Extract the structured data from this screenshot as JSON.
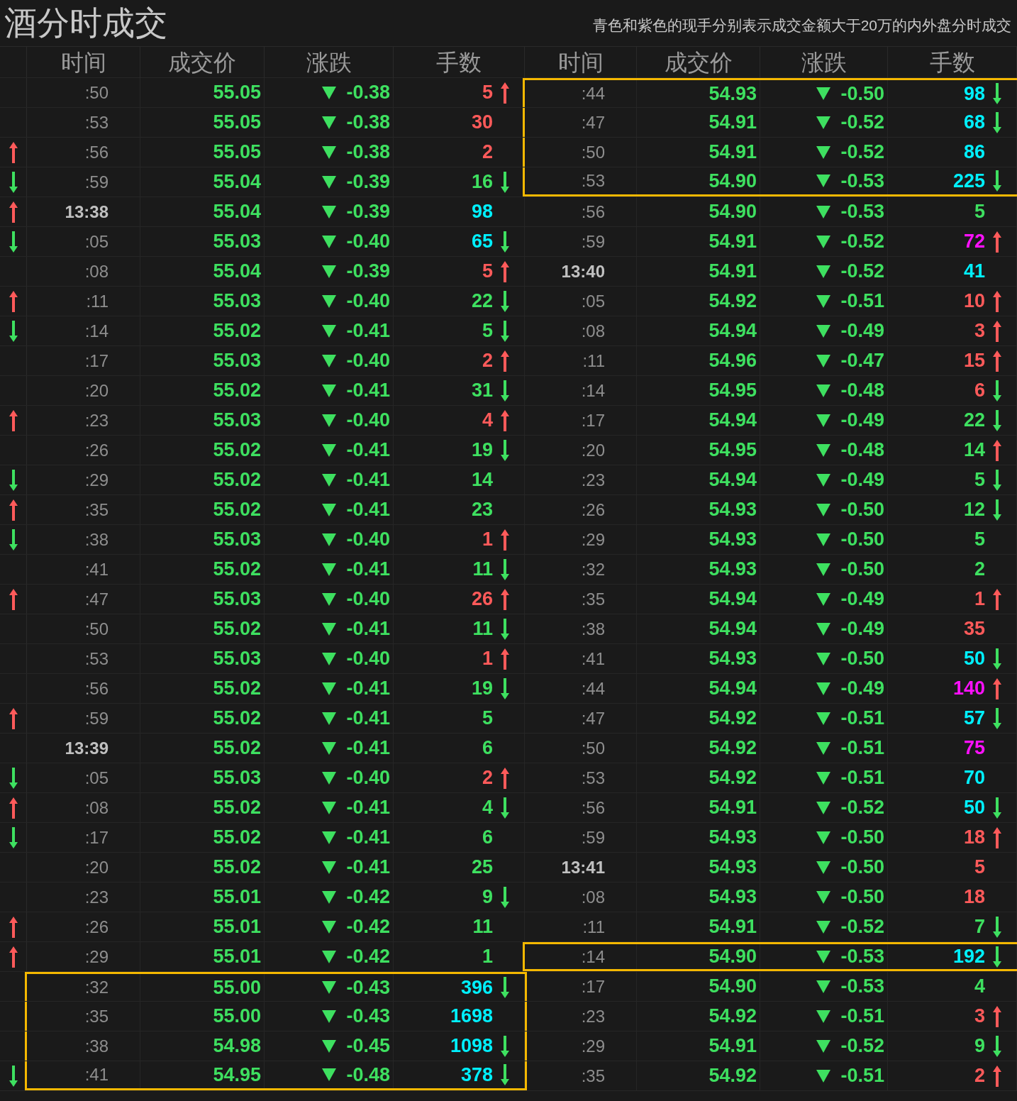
{
  "title": "酒分时成交",
  "notice": "青色和紫色的现手分别表示成交金额大于20万的内外盘分时成交",
  "columns": [
    "时间",
    "成交价",
    "涨跌",
    "手数"
  ],
  "right_columns": [
    "时间",
    "成交价",
    "涨跌",
    "手数"
  ],
  "left_rows": [
    {
      "time": ":50",
      "kind": "second",
      "price": "55.05",
      "falling": true,
      "change": "-0.38",
      "volume": "5",
      "color": "#ff5a5a",
      "arrow_up": true,
      "arrow_down": false,
      "edge_up": false,
      "edge_down": false,
      "highlighted": false
    },
    {
      "time": ":53",
      "kind": "second",
      "price": "55.05",
      "falling": true,
      "change": "-0.38",
      "volume": "30",
      "color": "#ff5a5a",
      "arrow_up": false,
      "arrow_down": false,
      "edge_up": false,
      "edge_down": false,
      "highlighted": false
    },
    {
      "time": ":56",
      "kind": "second",
      "price": "55.05",
      "falling": true,
      "change": "-0.38",
      "volume": "2",
      "color": "#ff5a5a",
      "arrow_up": false,
      "arrow_down": false,
      "edge_up": true,
      "edge_down": false,
      "highlighted": false
    },
    {
      "time": ":59",
      "kind": "second",
      "price": "55.04",
      "falling": true,
      "change": "-0.39",
      "volume": "16",
      "color": "#3ee060",
      "arrow_up": false,
      "arrow_down": true,
      "edge_up": false,
      "edge_down": true,
      "highlighted": false
    },
    {
      "time": "13:38",
      "kind": "minute",
      "price": "55.04",
      "falling": true,
      "change": "-0.39",
      "volume": "98",
      "color": "#00f0ff",
      "arrow_up": false,
      "arrow_down": false,
      "edge_up": true,
      "edge_down": false,
      "highlighted": false
    },
    {
      "time": ":05",
      "kind": "second",
      "price": "55.03",
      "falling": true,
      "change": "-0.40",
      "volume": "65",
      "color": "#00f0ff",
      "arrow_up": false,
      "arrow_down": true,
      "edge_up": false,
      "edge_down": true,
      "highlighted": false
    },
    {
      "time": ":08",
      "kind": "second",
      "price": "55.04",
      "falling": true,
      "change": "-0.39",
      "volume": "5",
      "color": "#ff5a5a",
      "arrow_up": true,
      "arrow_down": false,
      "edge_up": false,
      "edge_down": false,
      "highlighted": false
    },
    {
      "time": ":11",
      "kind": "second",
      "price": "55.03",
      "falling": true,
      "change": "-0.40",
      "volume": "22",
      "color": "#3ee060",
      "arrow_up": false,
      "arrow_down": true,
      "edge_up": true,
      "edge_down": false,
      "highlighted": false
    },
    {
      "time": ":14",
      "kind": "second",
      "price": "55.02",
      "falling": true,
      "change": "-0.41",
      "volume": "5",
      "color": "#3ee060",
      "arrow_up": false,
      "arrow_down": true,
      "edge_up": false,
      "edge_down": true,
      "highlighted": false
    },
    {
      "time": ":17",
      "kind": "second",
      "price": "55.03",
      "falling": true,
      "change": "-0.40",
      "volume": "2",
      "color": "#ff5a5a",
      "arrow_up": true,
      "arrow_down": false,
      "edge_up": false,
      "edge_down": false,
      "highlighted": false
    },
    {
      "time": ":20",
      "kind": "second",
      "price": "55.02",
      "falling": true,
      "change": "-0.41",
      "volume": "31",
      "color": "#3ee060",
      "arrow_up": false,
      "arrow_down": true,
      "edge_up": false,
      "edge_down": false,
      "highlighted": false
    },
    {
      "time": ":23",
      "kind": "second",
      "price": "55.03",
      "falling": true,
      "change": "-0.40",
      "volume": "4",
      "color": "#ff5a5a",
      "arrow_up": true,
      "arrow_down": false,
      "edge_up": true,
      "edge_down": false,
      "highlighted": false
    },
    {
      "time": ":26",
      "kind": "second",
      "price": "55.02",
      "falling": true,
      "change": "-0.41",
      "volume": "19",
      "color": "#3ee060",
      "arrow_up": false,
      "arrow_down": true,
      "edge_up": false,
      "edge_down": false,
      "highlighted": false
    },
    {
      "time": ":29",
      "kind": "second",
      "price": "55.02",
      "falling": true,
      "change": "-0.41",
      "volume": "14",
      "color": "#3ee060",
      "arrow_up": false,
      "arrow_down": false,
      "edge_up": false,
      "edge_down": true,
      "highlighted": false
    },
    {
      "time": ":35",
      "kind": "second",
      "price": "55.02",
      "falling": true,
      "change": "-0.41",
      "volume": "23",
      "color": "#3ee060",
      "arrow_up": false,
      "arrow_down": false,
      "edge_up": true,
      "edge_down": false,
      "highlighted": false
    },
    {
      "time": ":38",
      "kind": "second",
      "price": "55.03",
      "falling": true,
      "change": "-0.40",
      "volume": "1",
      "color": "#ff5a5a",
      "arrow_up": true,
      "arrow_down": false,
      "edge_up": false,
      "edge_down": true,
      "highlighted": false
    },
    {
      "time": ":41",
      "kind": "second",
      "price": "55.02",
      "falling": true,
      "change": "-0.41",
      "volume": "11",
      "color": "#3ee060",
      "arrow_up": false,
      "arrow_down": true,
      "edge_up": false,
      "edge_down": false,
      "highlighted": false
    },
    {
      "time": ":47",
      "kind": "second",
      "price": "55.03",
      "falling": true,
      "change": "-0.40",
      "volume": "26",
      "color": "#ff5a5a",
      "arrow_up": true,
      "arrow_down": false,
      "edge_up": true,
      "edge_down": false,
      "highlighted": false
    },
    {
      "time": ":50",
      "kind": "second",
      "price": "55.02",
      "falling": true,
      "change": "-0.41",
      "volume": "11",
      "color": "#3ee060",
      "arrow_up": false,
      "arrow_down": true,
      "edge_up": false,
      "edge_down": false,
      "highlighted": false
    },
    {
      "time": ":53",
      "kind": "second",
      "price": "55.03",
      "falling": true,
      "change": "-0.40",
      "volume": "1",
      "color": "#ff5a5a",
      "arrow_up": true,
      "arrow_down": false,
      "edge_up": false,
      "edge_down": false,
      "highlighted": false
    },
    {
      "time": ":56",
      "kind": "second",
      "price": "55.02",
      "falling": true,
      "change": "-0.41",
      "volume": "19",
      "color": "#3ee060",
      "arrow_up": false,
      "arrow_down": true,
      "edge_up": false,
      "edge_down": false,
      "highlighted": false
    },
    {
      "time": ":59",
      "kind": "second",
      "price": "55.02",
      "falling": true,
      "change": "-0.41",
      "volume": "5",
      "color": "#3ee060",
      "arrow_up": false,
      "arrow_down": false,
      "edge_up": true,
      "edge_down": false,
      "highlighted": false
    },
    {
      "time": "13:39",
      "kind": "minute",
      "price": "55.02",
      "falling": true,
      "change": "-0.41",
      "volume": "6",
      "color": "#3ee060",
      "arrow_up": false,
      "arrow_down": false,
      "edge_up": false,
      "edge_down": false,
      "highlighted": false
    },
    {
      "time": ":05",
      "kind": "second",
      "price": "55.03",
      "falling": true,
      "change": "-0.40",
      "volume": "2",
      "color": "#ff5a5a",
      "arrow_up": true,
      "arrow_down": false,
      "edge_up": false,
      "edge_down": true,
      "highlighted": false
    },
    {
      "time": ":08",
      "kind": "second",
      "price": "55.02",
      "falling": true,
      "change": "-0.41",
      "volume": "4",
      "color": "#3ee060",
      "arrow_up": false,
      "arrow_down": true,
      "edge_up": true,
      "edge_down": false,
      "highlighted": false
    },
    {
      "time": ":17",
      "kind": "second",
      "price": "55.02",
      "falling": true,
      "change": "-0.41",
      "volume": "6",
      "color": "#3ee060",
      "arrow_up": false,
      "arrow_down": false,
      "edge_up": false,
      "edge_down": true,
      "highlighted": false
    },
    {
      "time": ":20",
      "kind": "second",
      "price": "55.02",
      "falling": true,
      "change": "-0.41",
      "volume": "25",
      "color": "#3ee060",
      "arrow_up": false,
      "arrow_down": false,
      "edge_up": false,
      "edge_down": false,
      "highlighted": false
    },
    {
      "time": ":23",
      "kind": "second",
      "price": "55.01",
      "falling": true,
      "change": "-0.42",
      "volume": "9",
      "color": "#3ee060",
      "arrow_up": false,
      "arrow_down": true,
      "edge_up": false,
      "edge_down": false,
      "highlighted": false
    },
    {
      "time": ":26",
      "kind": "second",
      "price": "55.01",
      "falling": true,
      "change": "-0.42",
      "volume": "11",
      "color": "#3ee060",
      "arrow_up": false,
      "arrow_down": false,
      "edge_up": true,
      "edge_down": false,
      "highlighted": false
    },
    {
      "time": ":29",
      "kind": "second",
      "price": "55.01",
      "falling": true,
      "change": "-0.42",
      "volume": "1",
      "color": "#3ee060",
      "arrow_up": false,
      "arrow_down": false,
      "edge_up": true,
      "edge_down": false,
      "highlighted": false
    },
    {
      "time": ":32",
      "kind": "second",
      "price": "55.00",
      "falling": true,
      "change": "-0.43",
      "volume": "396",
      "color": "#00f0ff",
      "arrow_up": false,
      "arrow_down": true,
      "edge_up": false,
      "edge_down": false,
      "highlighted": true
    },
    {
      "time": ":35",
      "kind": "second",
      "price": "55.00",
      "falling": true,
      "change": "-0.43",
      "volume": "1698",
      "color": "#00f0ff",
      "arrow_up": false,
      "arrow_down": false,
      "edge_up": false,
      "edge_down": false,
      "highlighted": true
    },
    {
      "time": ":38",
      "kind": "second",
      "price": "54.98",
      "falling": true,
      "change": "-0.45",
      "volume": "1098",
      "color": "#00f0ff",
      "arrow_up": false,
      "arrow_down": true,
      "edge_up": false,
      "edge_down": false,
      "highlighted": true
    },
    {
      "time": ":41",
      "kind": "second",
      "price": "54.95",
      "falling": true,
      "change": "-0.48",
      "volume": "378",
      "color": "#00f0ff",
      "arrow_up": false,
      "arrow_down": true,
      "edge_up": false,
      "edge_down": true,
      "highlighted": true
    }
  ],
  "right_rows": [
    {
      "time": ":44",
      "kind": "second",
      "price": "54.93",
      "falling": true,
      "change": "-0.50",
      "volume": "98",
      "color": "#00f0ff",
      "arrow_up": false,
      "arrow_down": true,
      "highlighted": true
    },
    {
      "time": ":47",
      "kind": "second",
      "price": "54.91",
      "falling": true,
      "change": "-0.52",
      "volume": "68",
      "color": "#00f0ff",
      "arrow_up": false,
      "arrow_down": true,
      "highlighted": true
    },
    {
      "time": ":50",
      "kind": "second",
      "price": "54.91",
      "falling": true,
      "change": "-0.52",
      "volume": "86",
      "color": "#00f0ff",
      "arrow_up": false,
      "arrow_down": false,
      "highlighted": true
    },
    {
      "time": ":53",
      "kind": "second",
      "price": "54.90",
      "falling": true,
      "change": "-0.53",
      "volume": "225",
      "color": "#00f0ff",
      "arrow_up": false,
      "arrow_down": true,
      "highlighted": true
    },
    {
      "time": ":56",
      "kind": "second",
      "price": "54.90",
      "falling": true,
      "change": "-0.53",
      "volume": "5",
      "color": "#3ee060",
      "arrow_up": false,
      "arrow_down": false,
      "highlighted": false
    },
    {
      "time": ":59",
      "kind": "second",
      "price": "54.91",
      "falling": true,
      "change": "-0.52",
      "volume": "72",
      "color": "#ff10ff",
      "arrow_up": true,
      "arrow_down": false,
      "highlighted": false
    },
    {
      "time": "13:40",
      "kind": "minute",
      "price": "54.91",
      "falling": true,
      "change": "-0.52",
      "volume": "41",
      "color": "#00f0ff",
      "arrow_up": false,
      "arrow_down": false,
      "highlighted": false
    },
    {
      "time": ":05",
      "kind": "second",
      "price": "54.92",
      "falling": true,
      "change": "-0.51",
      "volume": "10",
      "color": "#ff5a5a",
      "arrow_up": true,
      "arrow_down": false,
      "highlighted": false
    },
    {
      "time": ":08",
      "kind": "second",
      "price": "54.94",
      "falling": true,
      "change": "-0.49",
      "volume": "3",
      "color": "#ff5a5a",
      "arrow_up": true,
      "arrow_down": false,
      "highlighted": false
    },
    {
      "time": ":11",
      "kind": "second",
      "price": "54.96",
      "falling": true,
      "change": "-0.47",
      "volume": "15",
      "color": "#ff5a5a",
      "arrow_up": true,
      "arrow_down": false,
      "highlighted": false
    },
    {
      "time": ":14",
      "kind": "second",
      "price": "54.95",
      "falling": true,
      "change": "-0.48",
      "volume": "6",
      "color": "#ff5a5a",
      "arrow_up": false,
      "arrow_down": true,
      "highlighted": false
    },
    {
      "time": ":17",
      "kind": "second",
      "price": "54.94",
      "falling": true,
      "change": "-0.49",
      "volume": "22",
      "color": "#3ee060",
      "arrow_up": false,
      "arrow_down": true,
      "highlighted": false
    },
    {
      "time": ":20",
      "kind": "second",
      "price": "54.95",
      "falling": true,
      "change": "-0.48",
      "volume": "14",
      "color": "#3ee060",
      "arrow_up": true,
      "arrow_down": false,
      "highlighted": false
    },
    {
      "time": ":23",
      "kind": "second",
      "price": "54.94",
      "falling": true,
      "change": "-0.49",
      "volume": "5",
      "color": "#3ee060",
      "arrow_up": false,
      "arrow_down": true,
      "highlighted": false
    },
    {
      "time": ":26",
      "kind": "second",
      "price": "54.93",
      "falling": true,
      "change": "-0.50",
      "volume": "12",
      "color": "#3ee060",
      "arrow_up": false,
      "arrow_down": true,
      "highlighted": false
    },
    {
      "time": ":29",
      "kind": "second",
      "price": "54.93",
      "falling": true,
      "change": "-0.50",
      "volume": "5",
      "color": "#3ee060",
      "arrow_up": false,
      "arrow_down": false,
      "highlighted": false
    },
    {
      "time": ":32",
      "kind": "second",
      "price": "54.93",
      "falling": true,
      "change": "-0.50",
      "volume": "2",
      "color": "#3ee060",
      "arrow_up": false,
      "arrow_down": false,
      "highlighted": false
    },
    {
      "time": ":35",
      "kind": "second",
      "price": "54.94",
      "falling": true,
      "change": "-0.49",
      "volume": "1",
      "color": "#ff5a5a",
      "arrow_up": true,
      "arrow_down": false,
      "highlighted": false
    },
    {
      "time": ":38",
      "kind": "second",
      "price": "54.94",
      "falling": true,
      "change": "-0.49",
      "volume": "35",
      "color": "#ff5a5a",
      "arrow_up": false,
      "arrow_down": false,
      "highlighted": false
    },
    {
      "time": ":41",
      "kind": "second",
      "price": "54.93",
      "falling": true,
      "change": "-0.50",
      "volume": "50",
      "color": "#00f0ff",
      "arrow_up": false,
      "arrow_down": true,
      "highlighted": false
    },
    {
      "time": ":44",
      "kind": "second",
      "price": "54.94",
      "falling": true,
      "change": "-0.49",
      "volume": "140",
      "color": "#ff10ff",
      "arrow_up": true,
      "arrow_down": false,
      "highlighted": false
    },
    {
      "time": ":47",
      "kind": "second",
      "price": "54.92",
      "falling": true,
      "change": "-0.51",
      "volume": "57",
      "color": "#00f0ff",
      "arrow_up": false,
      "arrow_down": true,
      "highlighted": false
    },
    {
      "time": ":50",
      "kind": "second",
      "price": "54.92",
      "falling": true,
      "change": "-0.51",
      "volume": "75",
      "color": "#ff10ff",
      "arrow_up": false,
      "arrow_down": false,
      "highlighted": false
    },
    {
      "time": ":53",
      "kind": "second",
      "price": "54.92",
      "falling": true,
      "change": "-0.51",
      "volume": "70",
      "color": "#00f0ff",
      "arrow_up": false,
      "arrow_down": false,
      "highlighted": false
    },
    {
      "time": ":56",
      "kind": "second",
      "price": "54.91",
      "falling": true,
      "change": "-0.52",
      "volume": "50",
      "color": "#00f0ff",
      "arrow_up": false,
      "arrow_down": true,
      "highlighted": false
    },
    {
      "time": ":59",
      "kind": "second",
      "price": "54.93",
      "falling": true,
      "change": "-0.50",
      "volume": "18",
      "color": "#ff5a5a",
      "arrow_up": true,
      "arrow_down": false,
      "highlighted": false
    },
    {
      "time": "13:41",
      "kind": "minute",
      "price": "54.93",
      "falling": true,
      "change": "-0.50",
      "volume": "5",
      "color": "#ff5a5a",
      "arrow_up": false,
      "arrow_down": false,
      "highlighted": false
    },
    {
      "time": ":08",
      "kind": "second",
      "price": "54.93",
      "falling": true,
      "change": "-0.50",
      "volume": "18",
      "color": "#ff5a5a",
      "arrow_up": false,
      "arrow_down": false,
      "highlighted": false
    },
    {
      "time": ":11",
      "kind": "second",
      "price": "54.91",
      "falling": true,
      "change": "-0.52",
      "volume": "7",
      "color": "#3ee060",
      "arrow_up": false,
      "arrow_down": true,
      "highlighted": false
    },
    {
      "time": ":14",
      "kind": "second",
      "price": "54.90",
      "falling": true,
      "change": "-0.53",
      "volume": "192",
      "color": "#00f0ff",
      "arrow_up": false,
      "arrow_down": true,
      "highlighted": true
    },
    {
      "time": ":17",
      "kind": "second",
      "price": "54.90",
      "falling": true,
      "change": "-0.53",
      "volume": "4",
      "color": "#3ee060",
      "arrow_up": false,
      "arrow_down": false,
      "highlighted": false
    },
    {
      "time": ":23",
      "kind": "second",
      "price": "54.92",
      "falling": true,
      "change": "-0.51",
      "volume": "3",
      "color": "#ff5a5a",
      "arrow_up": true,
      "arrow_down": false,
      "highlighted": false
    },
    {
      "time": ":29",
      "kind": "second",
      "price": "54.91",
      "falling": true,
      "change": "-0.52",
      "volume": "9",
      "color": "#3ee060",
      "arrow_up": false,
      "arrow_down": true,
      "highlighted": false
    },
    {
      "time": ":35",
      "kind": "second",
      "price": "54.92",
      "falling": true,
      "change": "-0.51",
      "volume": "2",
      "color": "#ff5a5a",
      "arrow_up": true,
      "arrow_down": false,
      "highlighted": false
    }
  ]
}
